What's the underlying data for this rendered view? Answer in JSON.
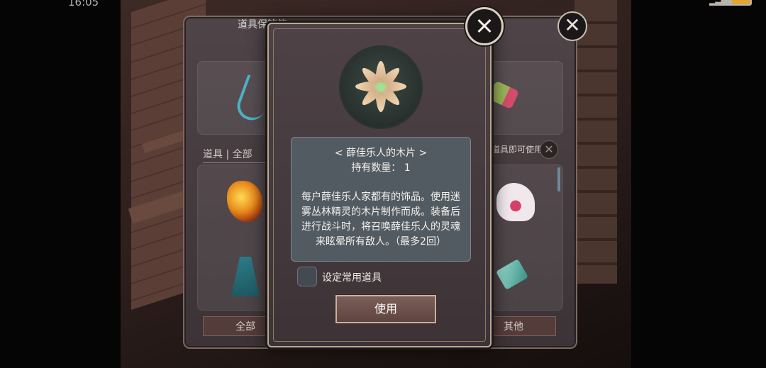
{
  "status_bar": {
    "time": "16:05"
  },
  "back_panel": {
    "title": "道具保管箱",
    "tab_label": "道具 | 全部",
    "side_text": "道具即可使用",
    "filter_all": "全部",
    "filter_other": "其他"
  },
  "modal": {
    "item_name": "< 薛佳乐人的木片 >",
    "quantity_line": "持有数量： 1",
    "description": "每户薛佳乐人家都有的饰品。使用迷雾丛林精灵的木片制作而成。装备后进行战斗时，将召唤薛佳乐人的灵魂来眩晕所有敌人。（最多2回）",
    "favorite_label": "设定常用道具",
    "use_button": "使用"
  },
  "icons": [
    "close-icon",
    "item-wood-chip-icon",
    "checkbox-icon"
  ],
  "colors": {
    "accent_border": "#b9a98f",
    "desc_bg": "#535b62",
    "button_bg": "#6b504b"
  }
}
